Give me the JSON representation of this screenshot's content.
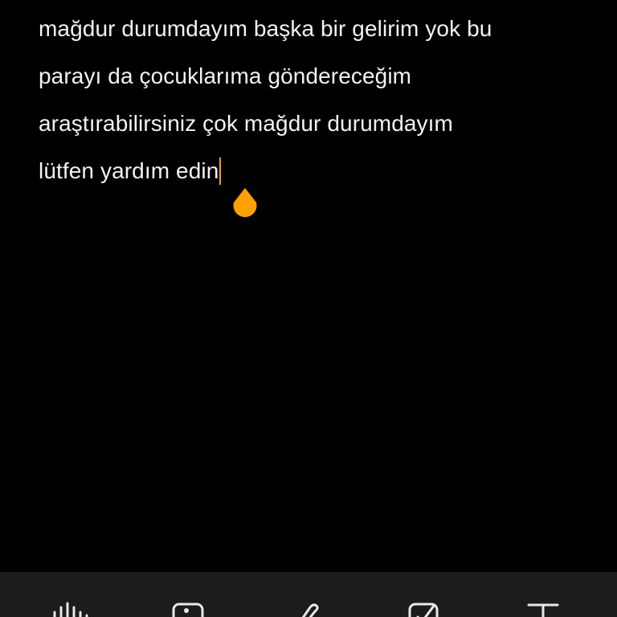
{
  "note": {
    "lines": [
      "mağdur durumdayım başka bir gelirim yok bu",
      "parayı da çocuklarıma göndereceğim",
      "araştırabilirsiniz çok mağdur durumdayım",
      "lütfen yardım edin"
    ]
  },
  "colors": {
    "background": "#000000",
    "text": "#f2f2f2",
    "accent": "#ffa000",
    "toolbar": "#1c1c1c"
  },
  "toolbar": {
    "tools": [
      "voice-icon",
      "image-icon",
      "pen-icon",
      "checkbox-icon",
      "text-format-icon"
    ]
  }
}
